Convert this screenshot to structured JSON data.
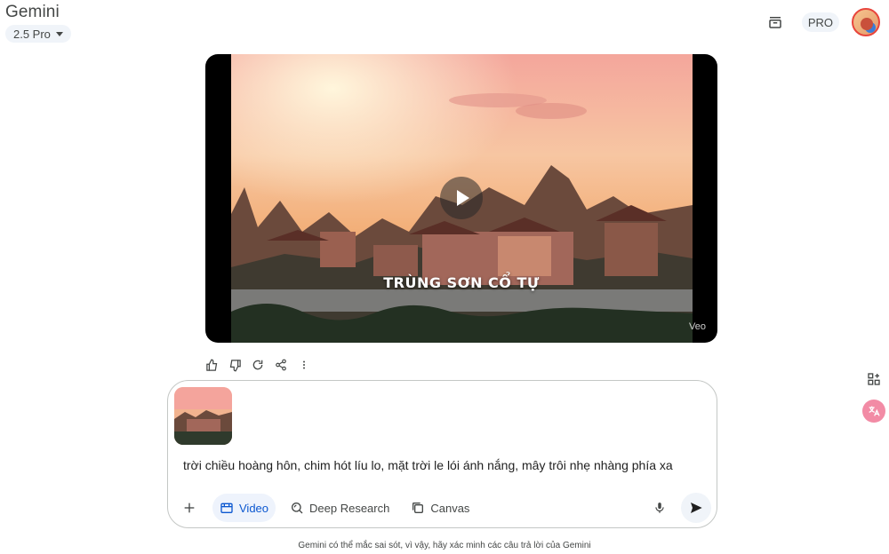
{
  "header": {
    "app_title": "Gemini",
    "model_selector": "2.5 Pro",
    "plan_badge": "PRO"
  },
  "video": {
    "overlay_title": "TRÙNG SƠN CỔ TỰ",
    "watermark": "Veo"
  },
  "composer": {
    "prompt_text": "trời chiều hoàng hôn, chim hót líu lo, mặt trời le lói ánh nắng, mây trôi nhẹ nhàng phía xa",
    "tools": [
      {
        "label": "Video",
        "icon": "video-icon",
        "active": true
      },
      {
        "label": "Deep Research",
        "icon": "deep-research-icon",
        "active": false
      },
      {
        "label": "Canvas",
        "icon": "canvas-icon",
        "active": false
      }
    ]
  },
  "footer": {
    "disclaimer": "Gemini có thể mắc sai sót, vì vậy, hãy xác minh các câu trả lời của Gemini"
  },
  "colors": {
    "accent": "#0b57d0",
    "surface": "#f0f4f9",
    "border": "#c4c7c5"
  }
}
